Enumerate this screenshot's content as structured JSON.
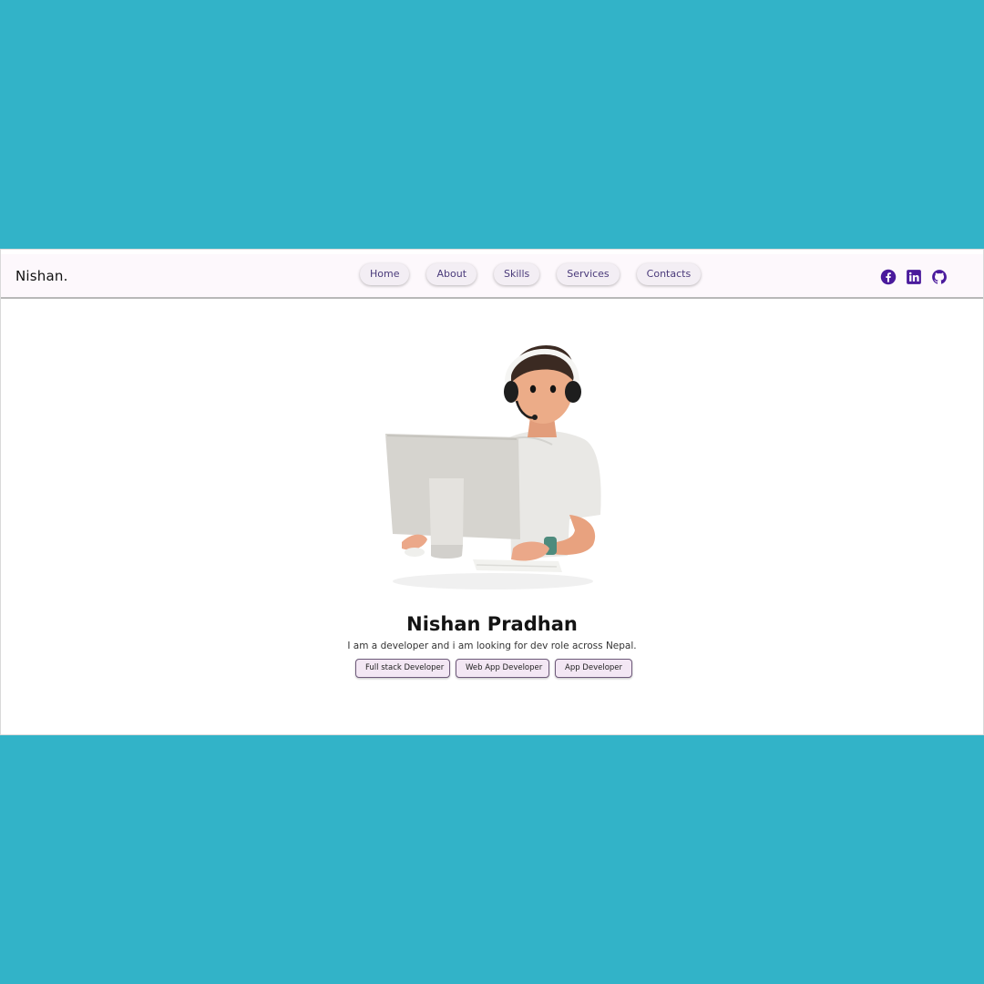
{
  "brand": {
    "name": "Nishan."
  },
  "nav": {
    "items": [
      {
        "label": "Home"
      },
      {
        "label": "About"
      },
      {
        "label": "Skills"
      },
      {
        "label": "Services"
      },
      {
        "label": "Contacts"
      }
    ]
  },
  "socials": [
    {
      "icon": "facebook-icon"
    },
    {
      "icon": "linkedin-icon"
    },
    {
      "icon": "github-icon"
    }
  ],
  "colors": {
    "background": "#32b3c8",
    "accent": "#4a1a9c",
    "nav_text": "#4a3a7a",
    "chip_bg": "#f3e7f4"
  },
  "hero": {
    "name": "Nishan Pradhan",
    "tagline": "I am a developer and i am looking for dev role across Nepal.",
    "roles": [
      {
        "label": "Full stack Developer"
      },
      {
        "label": "Web App Developer"
      },
      {
        "label": "App Developer"
      }
    ]
  }
}
